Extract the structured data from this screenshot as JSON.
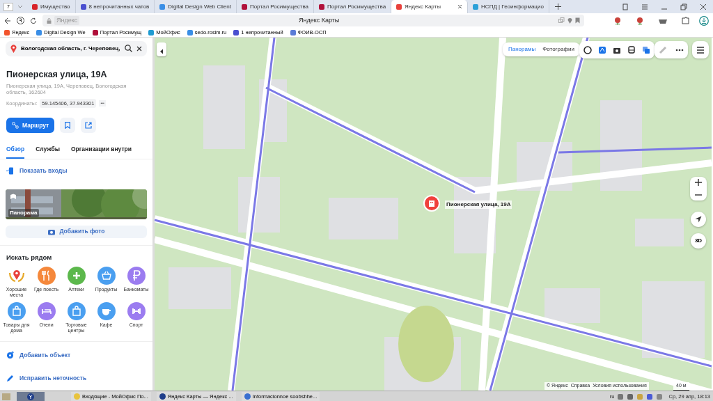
{
  "browser": {
    "tab_count": "7",
    "tabs": [
      {
        "label": "Имущество",
        "selected": false,
        "color": "#d8242a"
      },
      {
        "label": "8 непрочитанных чатов",
        "selected": false,
        "color": "#4a4fcf"
      },
      {
        "label": "Digital Design Web Client",
        "selected": false,
        "color": "#3a8ee6"
      },
      {
        "label": "Портал Росимущества",
        "selected": false,
        "color": "#b0103a"
      },
      {
        "label": "Портал Росимущества",
        "selected": false,
        "color": "#b0103a"
      },
      {
        "label": "Яндекс Карты",
        "selected": true,
        "color": "#e8413c"
      },
      {
        "label": "НСПД | Геоинформацио",
        "selected": false,
        "color": "#2aa0d8"
      }
    ],
    "address": {
      "domain": "Яндекс",
      "title": "Яндекс Карты"
    },
    "bookmarks": [
      {
        "label": "Яндекс",
        "color": "#f2542d"
      },
      {
        "label": "Digital Design We",
        "color": "#3a8ee6"
      },
      {
        "label": "Портал Росимущ",
        "color": "#b0103a"
      },
      {
        "label": "МойОфис",
        "color": "#1f9bd1"
      },
      {
        "label": "sedo.rosim.ru",
        "color": "#3a8ee6"
      },
      {
        "label": "1 непрочитанный",
        "color": "#4a4fcf"
      },
      {
        "label": "ФОИВ-ОСП",
        "color": "#5a7bd6"
      }
    ]
  },
  "panel": {
    "search": {
      "value": "Вологодская область, г. Череповец,"
    },
    "title": "Пионерская улица, 19А",
    "address": "Пионерская улица, 19А, Череповец, Вологодская область, 162604",
    "coords_label": "Координаты:",
    "coords": "59.145406, 37.943301",
    "coords_more": "•••",
    "route_button": "Маршрут",
    "tabs": [
      {
        "label": "Обзор",
        "selected": true
      },
      {
        "label": "Службы",
        "selected": false
      },
      {
        "label": "Организации внутри",
        "selected": false
      }
    ],
    "show_entrances": "Показать входы",
    "panorama": {
      "kind": "picture",
      "label": "Панорама"
    },
    "add_photo": "Добавить фото",
    "nearby": {
      "title": "Искать рядом",
      "categories": [
        {
          "label": "Хорошие места",
          "kind": "laurel",
          "color": "#e8413c"
        },
        {
          "label": "Где поесть",
          "kind": "circle",
          "color": "#f5883b"
        },
        {
          "label": "Аптеки",
          "kind": "circle",
          "color": "#5cb84c"
        },
        {
          "label": "Продукты",
          "kind": "circle",
          "color": "#4a9ff0"
        },
        {
          "label": "Банкоматы",
          "kind": "circle",
          "color": "#9b7cf0"
        },
        {
          "label": "Товары для дома",
          "kind": "circle",
          "color": "#4a9ff0"
        },
        {
          "label": "Отели",
          "kind": "circle",
          "color": "#9b7cf0"
        },
        {
          "label": "Торговые центры",
          "kind": "circle",
          "color": "#4a9ff0"
        },
        {
          "label": "Кафе",
          "kind": "circle",
          "color": "#4a9ff0"
        },
        {
          "label": "Спорт",
          "kind": "circle",
          "color": "#9b7cf0"
        }
      ]
    },
    "actions": [
      "Добавить объект",
      "Исправить неточность"
    ]
  },
  "map": {
    "layers": [
      {
        "label": "Панорамы",
        "selected": true
      },
      {
        "label": "Фотографии",
        "selected": false
      }
    ],
    "pin_label": "Пионерская улица, 19А",
    "zoom_control": "3D",
    "attribution": [
      "© Яндекс",
      "Справка",
      "Условия использования"
    ],
    "scale": "40 м"
  },
  "taskbar": {
    "items": [
      "Входящие - МойОфис По...",
      "Яндекс Карты — Яндекс ...",
      "Informacionnoe soobshhe..."
    ],
    "language": "ru",
    "clock": "Ср, 29 апр, 18:13"
  }
}
